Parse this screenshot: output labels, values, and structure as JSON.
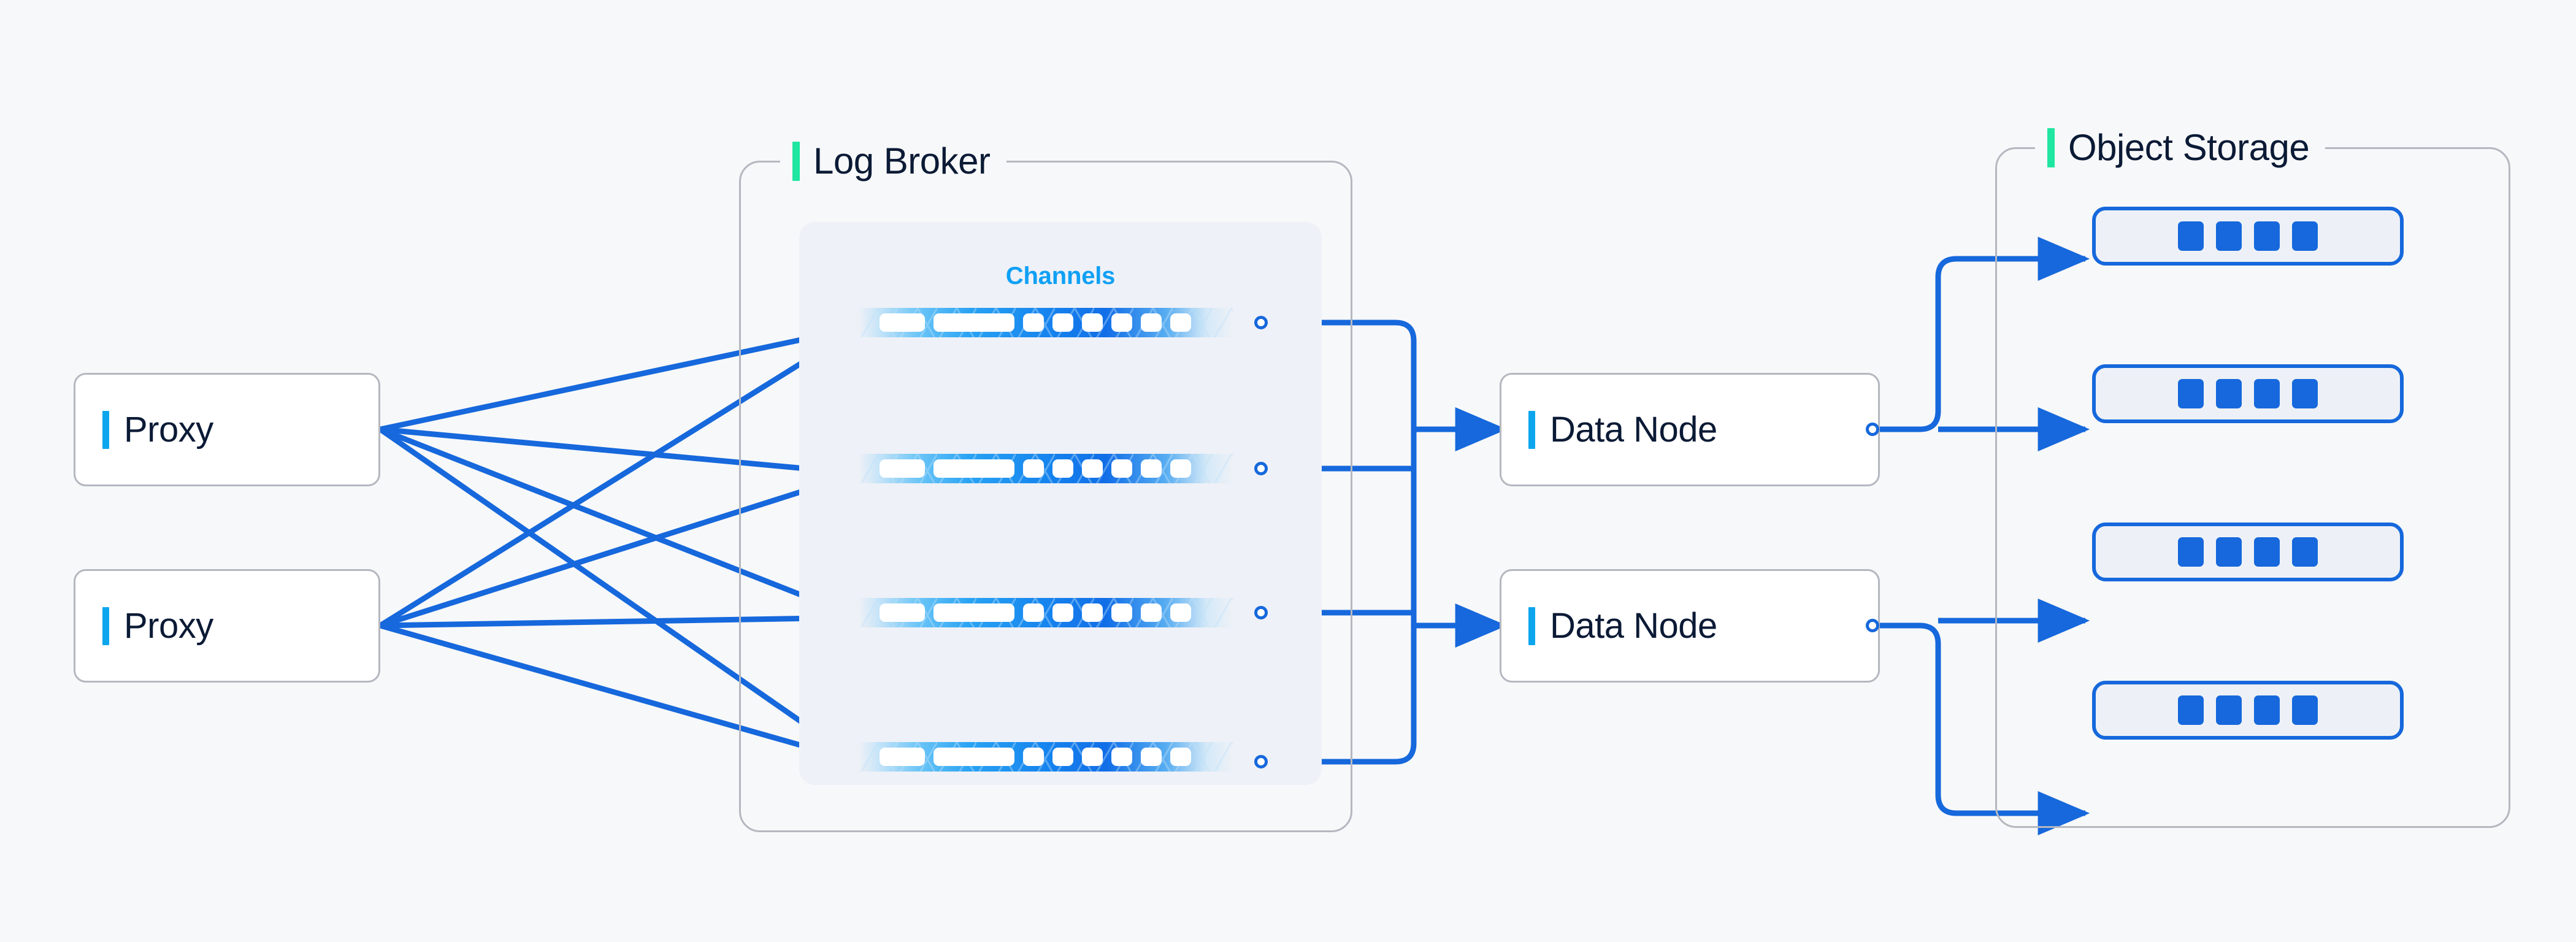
{
  "diagram": {
    "title": "Log Broker and Object Storage data flow architecture",
    "background_color": "#F7F8F9",
    "accent_green": "#1FE6A0",
    "accent_blue": "#0DA6EE",
    "wire_blue": "#1668DC",
    "text_dark": "#0B1A35",
    "border_gray": "#B5B7C0"
  },
  "groups": [
    {
      "id": "log-broker",
      "label": "Log Broker"
    },
    {
      "id": "object-storage",
      "label": "Object Storage"
    }
  ],
  "proxies": [
    {
      "label": "Proxy"
    },
    {
      "label": "Proxy"
    }
  ],
  "channels_panel": {
    "title": "Channels"
  },
  "channels": [
    {
      "id": "channel-1",
      "slots": [
        74,
        132,
        34,
        34,
        34,
        34,
        34,
        34
      ]
    },
    {
      "id": "channel-2",
      "slots": [
        74,
        132,
        34,
        34,
        34,
        34,
        34,
        34
      ]
    },
    {
      "id": "channel-3",
      "slots": [
        74,
        132,
        34,
        34,
        34,
        34,
        34,
        34
      ]
    },
    {
      "id": "channel-4",
      "slots": [
        74,
        132,
        34,
        34,
        34,
        34,
        34,
        34
      ]
    }
  ],
  "data_nodes": [
    {
      "label": "Data Node"
    },
    {
      "label": "Data Node"
    }
  ],
  "storage_boxes": [
    {
      "id": "storage-1",
      "units": 4
    },
    {
      "id": "storage-2",
      "units": 4
    },
    {
      "id": "storage-3",
      "units": 4
    },
    {
      "id": "storage-4",
      "units": 4
    }
  ],
  "connections": {
    "proxy_to_channels": "each proxy fans out to all four channels",
    "channels_to_data_nodes": "all four channel ports join a shared bus feeding both data nodes",
    "data_nodes_to_storage": "both data node ports join a shared bus feeding all four storage boxes"
  }
}
